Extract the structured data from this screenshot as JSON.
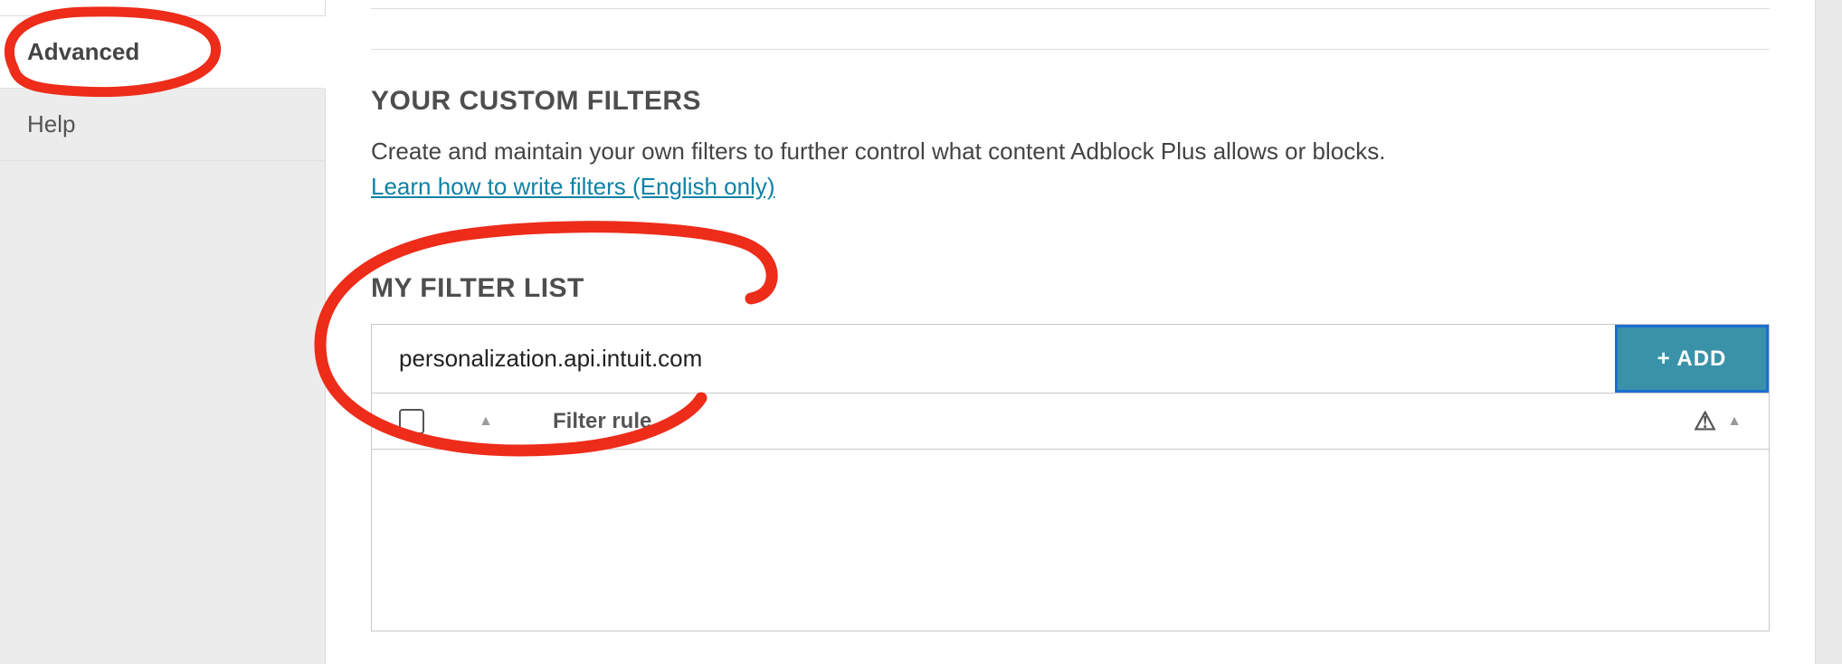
{
  "sidebar": {
    "items": [
      {
        "label": "Advanced"
      },
      {
        "label": "Help"
      }
    ]
  },
  "custom_filters": {
    "title": "YOUR CUSTOM FILTERS",
    "description": "Create and maintain your own filters to further control what content Adblock Plus allows or blocks.",
    "link_text": "Learn how to write filters (English only)"
  },
  "my_filter_list": {
    "title": "MY FILTER LIST",
    "input_value": "personalization.api.intuit.com",
    "add_button": "+ ADD",
    "columns": {
      "rule": "Filter rule"
    }
  },
  "icons": {
    "sort_caret": "▲",
    "warning": "⚠"
  }
}
